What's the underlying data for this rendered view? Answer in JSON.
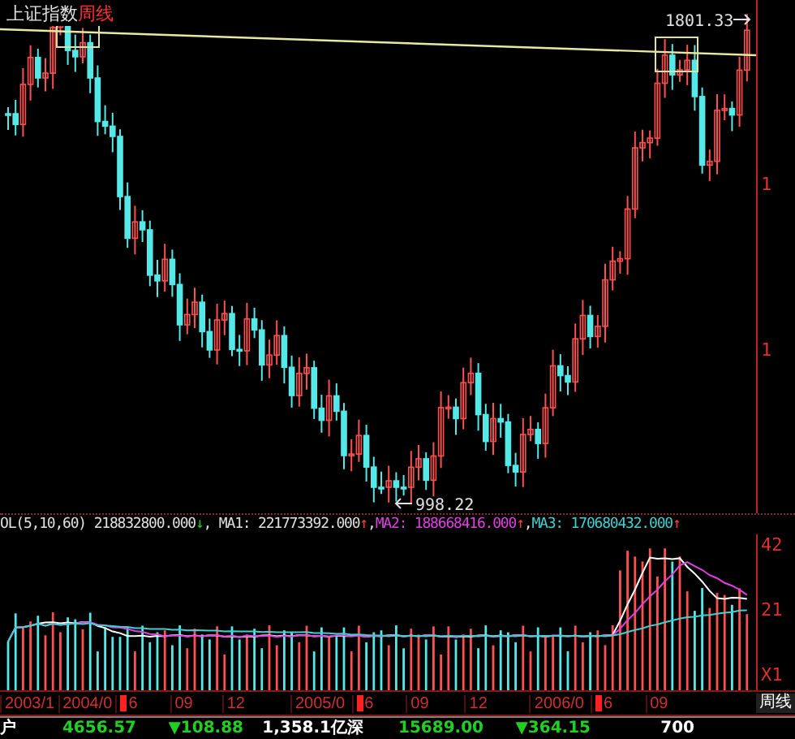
{
  "chart": {
    "index_name": "上证指数",
    "period": "周线",
    "high_label": "1801.33",
    "low_label": "998.22"
  },
  "price_axis": [
    "1",
    "1"
  ],
  "indicator_line": [
    {
      "kind": "plain",
      "text": "OL(5,10,60) 218832800.000"
    },
    {
      "kind": "down",
      "text": "↓"
    },
    {
      "kind": "plain",
      "text": ", MA1: 221773392.000"
    },
    {
      "kind": "up",
      "text": "↑"
    },
    {
      "kind": "plain",
      "text": ", "
    },
    {
      "kind": "ma2",
      "text": "MA2: 188668416.000"
    },
    {
      "kind": "up",
      "text": "↑"
    },
    {
      "kind": "plain",
      "text": ", "
    },
    {
      "kind": "ma3",
      "text": "MA3: 170680432.000"
    },
    {
      "kind": "up",
      "text": "↑"
    }
  ],
  "volume_axis": [
    "42",
    "21",
    "X1"
  ],
  "dates": [
    {
      "text": "2003/1",
      "marked": false
    },
    {
      "text": "2004/0",
      "marked": false
    },
    {
      "text": "6",
      "marked": true
    },
    {
      "text": "09",
      "marked": false
    },
    {
      "text": "12",
      "marked": false
    },
    {
      "text": "2005/0",
      "marked": false
    },
    {
      "text": "6",
      "marked": true
    },
    {
      "text": "09",
      "marked": false
    },
    {
      "text": "12",
      "marked": false
    },
    {
      "text": "2006/0",
      "marked": false
    },
    {
      "text": "6",
      "marked": true
    },
    {
      "text": "09",
      "marked": false
    }
  ],
  "period_tab": "周线",
  "status_bar": [
    {
      "kind": "label",
      "text": "户"
    },
    {
      "kind": "value",
      "text": "4656.57"
    },
    {
      "kind": "down",
      "text": "▼108.88"
    },
    {
      "kind": "plain",
      "text": "1,358.1亿"
    },
    {
      "kind": "label",
      "text": "深"
    },
    {
      "kind": "value",
      "text": "15689.00"
    },
    {
      "kind": "down",
      "text": "▼364.15"
    },
    {
      "kind": "plain",
      "text": "700"
    }
  ]
}
